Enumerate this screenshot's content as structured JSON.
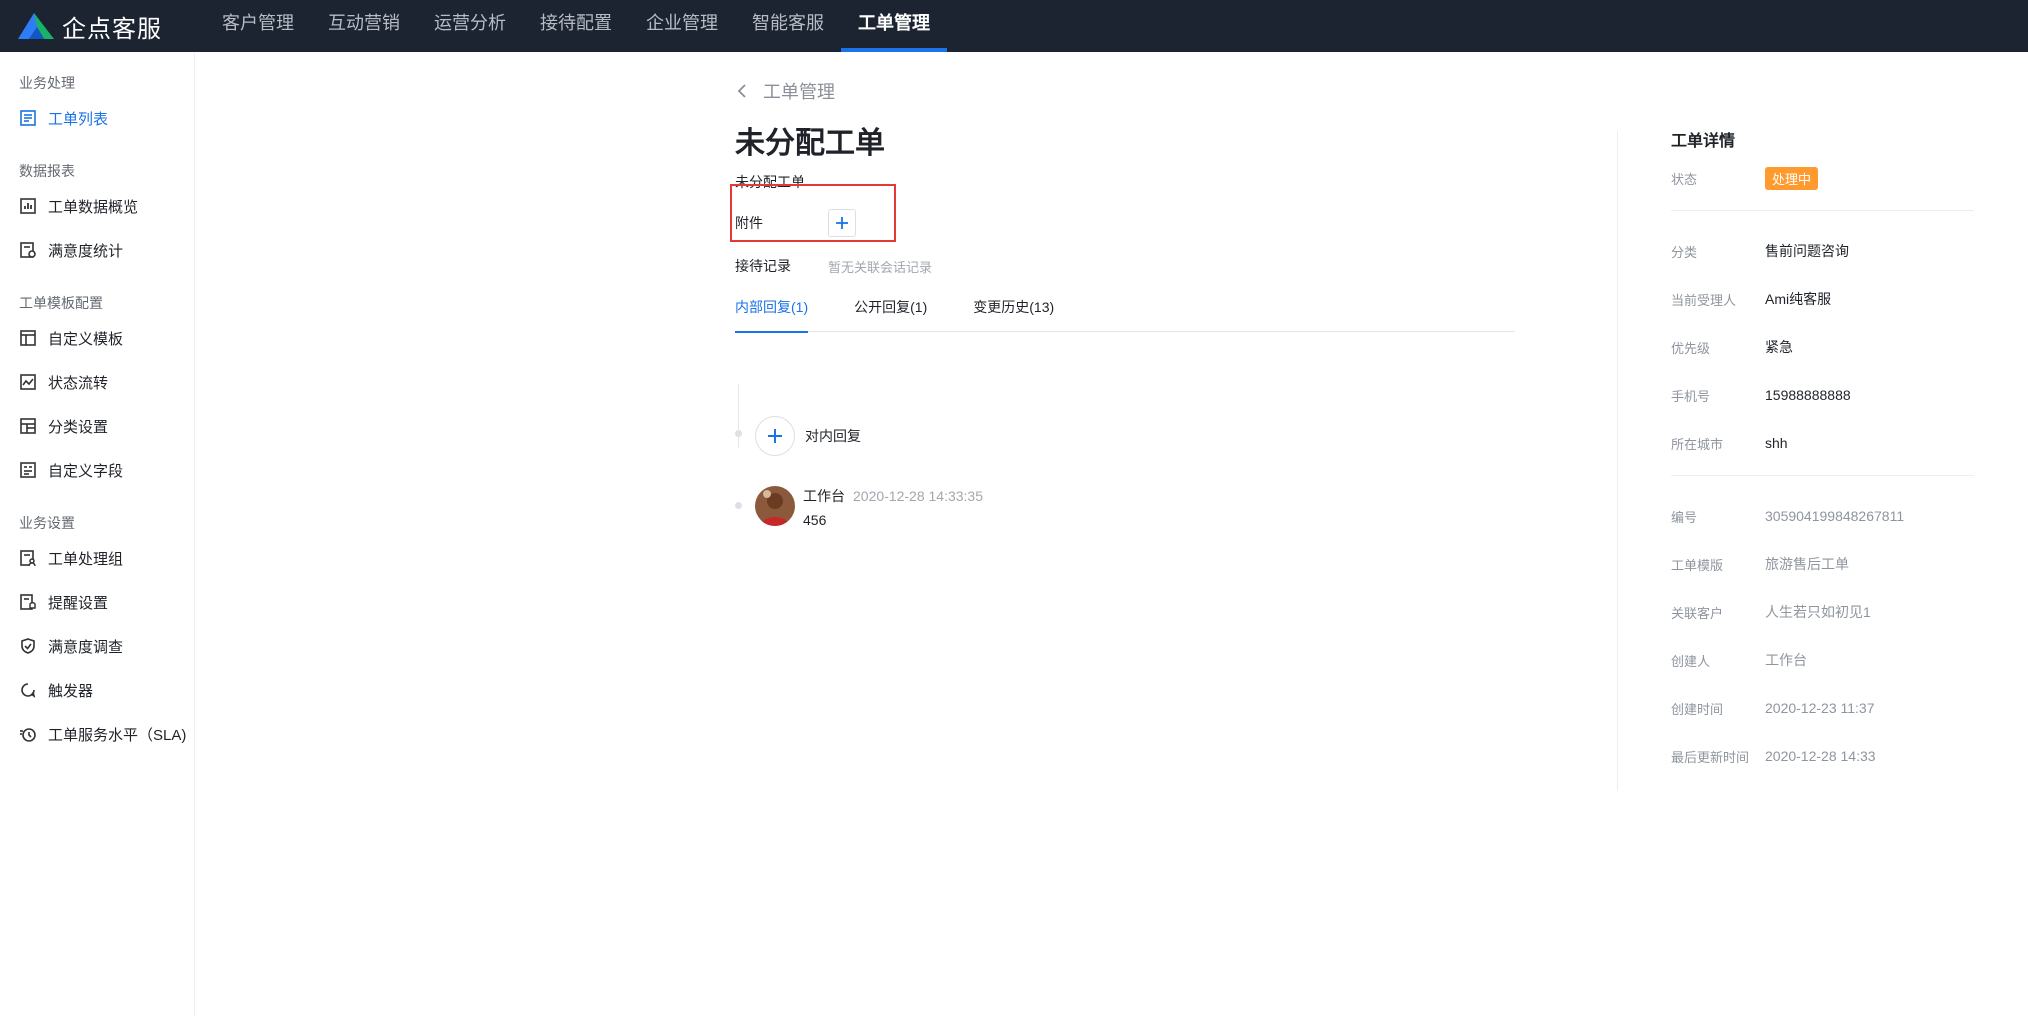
{
  "brand": {
    "name": "企点客服",
    "logo_icon": "qidian-logo-icon"
  },
  "nav": [
    {
      "label": "客户管理"
    },
    {
      "label": "互动营销"
    },
    {
      "label": "运营分析"
    },
    {
      "label": "接待配置"
    },
    {
      "label": "企业管理"
    },
    {
      "label": "智能客服"
    },
    {
      "label": "工单管理",
      "active": true
    }
  ],
  "sidebar": {
    "groups": [
      {
        "title": "业务处理",
        "items": [
          {
            "label": "工单列表",
            "icon": "list-doc-icon",
            "active": true
          }
        ]
      },
      {
        "title": "数据报表",
        "items": [
          {
            "label": "工单数据概览",
            "icon": "bar-chart-icon"
          },
          {
            "label": "满意度统计",
            "icon": "stats-doc-icon"
          }
        ]
      },
      {
        "title": "工单模板配置",
        "items": [
          {
            "label": "自定义模板",
            "icon": "layout-icon"
          },
          {
            "label": "状态流转",
            "icon": "trend-icon"
          },
          {
            "label": "分类设置",
            "icon": "grid-icon"
          },
          {
            "label": "自定义字段",
            "icon": "field-icon"
          }
        ]
      },
      {
        "title": "业务设置",
        "items": [
          {
            "label": "工单处理组",
            "icon": "group-doc-icon"
          },
          {
            "label": "提醒设置",
            "icon": "reminder-icon"
          },
          {
            "label": "满意度调查",
            "icon": "survey-icon"
          },
          {
            "label": "触发器",
            "icon": "trigger-icon"
          },
          {
            "label": "工单服务水平（SLA)",
            "icon": "clock-icon"
          }
        ]
      }
    ]
  },
  "main": {
    "back_label": "工单管理",
    "title": "未分配工单",
    "subtitle": "未分配工单",
    "attachment_label": "附件",
    "record_label": "接待记录",
    "record_empty": "暂无关联会话记录",
    "tabs": [
      {
        "label": "内部回复(1)",
        "active": true
      },
      {
        "label": "公开回复(1)"
      },
      {
        "label": "变更历史(13)"
      }
    ],
    "add_reply_label": "对内回复",
    "reply": {
      "author": "工作台",
      "time": "2020-12-28 14:33:35",
      "text": "456"
    }
  },
  "detail": {
    "title": "工单详情",
    "status_key": "状态",
    "status_value": "处理中",
    "status_color": "#ff9a2e",
    "section1": [
      {
        "key": "分类",
        "value": "售前问题咨询"
      },
      {
        "key": "当前受理人",
        "value": "Ami纯客服"
      },
      {
        "key": "优先级",
        "value": "紧急"
      },
      {
        "key": "手机号",
        "value": "15988888888"
      },
      {
        "key": "所在城市",
        "value": "shh"
      }
    ],
    "section2": [
      {
        "key": "编号",
        "value": "305904199848267811"
      },
      {
        "key": "工单模版",
        "value": "旅游售后工单"
      },
      {
        "key": "关联客户",
        "value": "人生若只如初见1"
      },
      {
        "key": "创建人",
        "value": "工作台"
      },
      {
        "key": "创建时间",
        "value": "2020-12-23 11:37"
      },
      {
        "key": "最后更新时间",
        "value": "2020-12-28 14:33"
      }
    ]
  },
  "colors": {
    "accent": "#1a73e8",
    "topbar": "#1c2331",
    "highlight": "#e53935"
  }
}
